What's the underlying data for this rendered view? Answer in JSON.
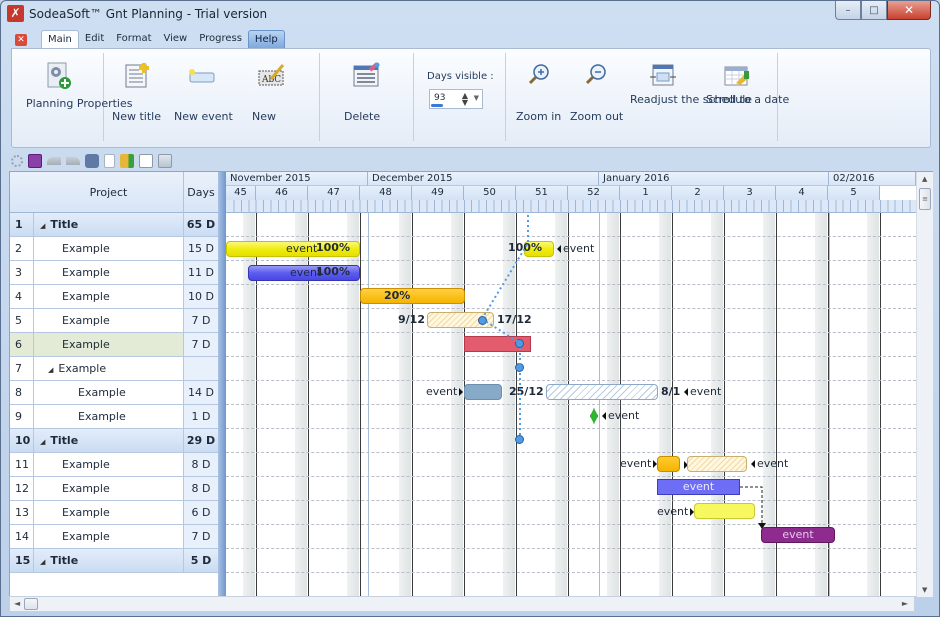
{
  "window": {
    "title": "SodeaSoft™ Gnt Planning - Trial version",
    "controls": {
      "minimize": "–",
      "maximize": "□",
      "close": "✕"
    }
  },
  "menu": {
    "file_icon": "close-icon",
    "tabs": [
      {
        "label": "Main",
        "active": true
      },
      {
        "label": "Edit"
      },
      {
        "label": "Format"
      },
      {
        "label": "View"
      },
      {
        "label": "Progress"
      },
      {
        "label": "Help",
        "highlighted": true
      }
    ]
  },
  "ribbon": {
    "planning_properties": "Planning Properties",
    "new_title": "New title",
    "new_event": "New event",
    "new": "New",
    "delete": "Delete",
    "days_visible_label": "Days visible :",
    "days_visible_value": "93",
    "days_visible_progress": 0.2,
    "zoom_in": "Zoom in",
    "zoom_out": "Zoom out",
    "readjust": "Readjust the schedule",
    "scroll_to_date": "Scroll to a date"
  },
  "quick_access": [
    "gear-icon",
    "save-icon",
    "undo-icon",
    "redo-icon",
    "print-icon",
    "new-document-icon",
    "export-icon",
    "print-preview-icon",
    "email-icon"
  ],
  "table": {
    "headers": {
      "project": "Project",
      "days": "Days"
    },
    "rows": [
      {
        "num": "1",
        "name": "Title",
        "days": "65 D",
        "type": "title",
        "level": 0,
        "expander": "◢"
      },
      {
        "num": "2",
        "name": "Example",
        "days": "15 D",
        "level": 1
      },
      {
        "num": "3",
        "name": "Example",
        "days": "11 D",
        "level": 1
      },
      {
        "num": "4",
        "name": "Example",
        "days": "10 D",
        "level": 1
      },
      {
        "num": "5",
        "name": "Example",
        "days": "7 D",
        "level": 1
      },
      {
        "num": "6",
        "name": "Example",
        "days": "7 D",
        "level": 1,
        "selected": true
      },
      {
        "num": "7",
        "name": "Example",
        "days": "",
        "level": 1,
        "expander": "◢"
      },
      {
        "num": "8",
        "name": "Example",
        "days": "14 D",
        "level": 2
      },
      {
        "num": "9",
        "name": "Example",
        "days": "1 D",
        "level": 2
      },
      {
        "num": "10",
        "name": "Title",
        "days": "29 D",
        "type": "title",
        "level": 0,
        "expander": "◢"
      },
      {
        "num": "11",
        "name": "Example",
        "days": "8 D",
        "level": 1
      },
      {
        "num": "12",
        "name": "Example",
        "days": "8 D",
        "level": 1
      },
      {
        "num": "13",
        "name": "Example",
        "days": "6 D",
        "level": 1
      },
      {
        "num": "14",
        "name": "Example",
        "days": "7 D",
        "level": 1
      },
      {
        "num": "15",
        "name": "Title",
        "days": "5 D",
        "type": "title",
        "level": 0,
        "expander": "◢"
      }
    ]
  },
  "timeline": {
    "months": [
      "November 2015",
      "December 2015",
      "January 2016",
      "02/2016"
    ],
    "weeks": [
      "45",
      "46",
      "47",
      "48",
      "49",
      "50",
      "51",
      "52",
      "1",
      "2",
      "3",
      "4",
      "5"
    ]
  },
  "gantt": {
    "labels": {
      "r2_event": "event",
      "r2_pct": "100%",
      "r2b_pct": "100%",
      "r2b_event": "event",
      "r3_event": "event",
      "r3_pct": "100%",
      "r4_pct": "20%",
      "r5_start": "9/12",
      "r5_end": "17/12",
      "r8_event": "event",
      "r8_start": "25/12",
      "r8_end": "8/1",
      "r8_event2": "event",
      "r9_event": "event",
      "r11_event": "event",
      "r11_event2": "event",
      "r12_text": "event",
      "r13_event": "event",
      "r14_text": "event"
    },
    "colors": {
      "yellow": "#f4f018",
      "blue": "#6a6af0",
      "orange": "#f5b400",
      "red": "#e35c6d",
      "steel": "#86aac8",
      "green": "#2fb52f",
      "purple": "#8e2b8e",
      "violet": "#6d6df5"
    }
  },
  "scrollbars": {
    "up": "▲",
    "down": "▼",
    "left": "◄",
    "right": "►",
    "grip": "≡"
  }
}
